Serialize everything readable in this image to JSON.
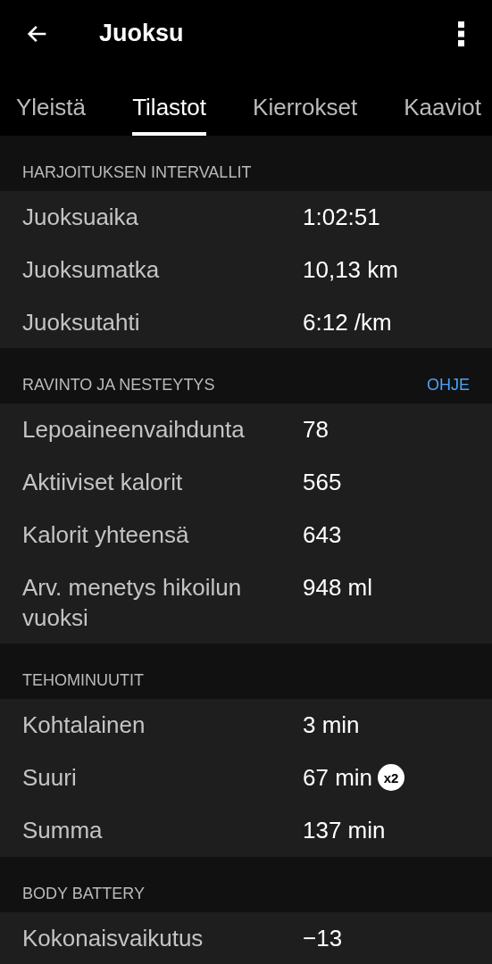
{
  "app_bar": {
    "title": "Juoksu"
  },
  "tabs": [
    {
      "label": "Yleistä",
      "selected": false
    },
    {
      "label": "Tilastot",
      "selected": true
    },
    {
      "label": "Kierrokset",
      "selected": false
    },
    {
      "label": "Kaaviot",
      "selected": false
    }
  ],
  "sections": [
    {
      "title": "HARJOITUKSEN INTERVALLIT",
      "rows": [
        {
          "label": "Juoksuaika",
          "value": "1:02:51"
        },
        {
          "label": "Juoksumatka",
          "value": "10,13 km"
        },
        {
          "label": "Juoksutahti",
          "value": "6:12 /km"
        }
      ]
    },
    {
      "title": "RAVINTO JA NESTEYTYS",
      "action": "OHJE",
      "rows": [
        {
          "label": "Lepoaineenvaihdunta",
          "value": "78"
        },
        {
          "label": "Aktiiviset kalorit",
          "value": "565"
        },
        {
          "label": "Kalorit yhteensä",
          "value": "643"
        },
        {
          "label": "Arv. menetys hikoilun vuoksi",
          "value": "948 ml"
        }
      ]
    },
    {
      "title": "TEHOMINUUTIT",
      "rows": [
        {
          "label": "Kohtalainen",
          "value": "3 min"
        },
        {
          "label": "Suuri",
          "value": "67 min",
          "badge": "x2"
        },
        {
          "label": "Summa",
          "value": "137 min"
        }
      ]
    },
    {
      "title": "BODY BATTERY",
      "rows": [
        {
          "label": "Kokonaisvaikutus",
          "value": "−13"
        }
      ]
    }
  ]
}
